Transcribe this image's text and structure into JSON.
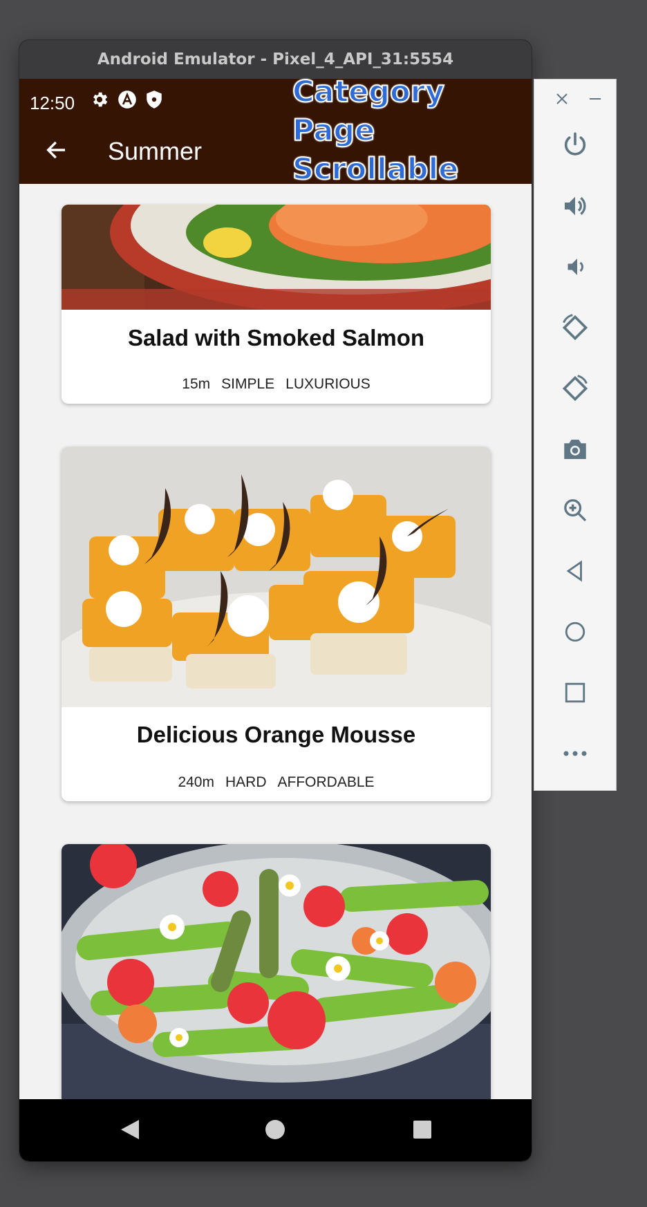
{
  "emulator": {
    "title": "Android Emulator - Pixel_4_API_31:5554"
  },
  "status_bar": {
    "time": "12:50"
  },
  "app_bar": {
    "title": "Summer"
  },
  "overlay": {
    "line1": "Category Page",
    "line2": "Scrollable"
  },
  "meals": [
    {
      "title": "Salad with Smoked Salmon",
      "duration": "15m",
      "complexity": "SIMPLE",
      "affordability": "LUXURIOUS"
    },
    {
      "title": "Delicious Orange Mousse",
      "duration": "240m",
      "complexity": "HARD",
      "affordability": "AFFORDABLE"
    },
    {
      "title": "",
      "duration": "",
      "complexity": "",
      "affordability": ""
    }
  ],
  "side_panel": {
    "icons": [
      "close-icon",
      "minimize-icon",
      "power-icon",
      "volume-up-icon",
      "volume-down-icon",
      "rotate-left-icon",
      "rotate-right-icon",
      "camera-icon",
      "zoom-icon",
      "back-icon",
      "home-icon",
      "overview-icon",
      "more-icon"
    ]
  },
  "colors": {
    "app_bar": "#361403",
    "background": "#f2f2f2",
    "overlay_text": "#2f6bd6",
    "side_icons": "#5f7785"
  }
}
